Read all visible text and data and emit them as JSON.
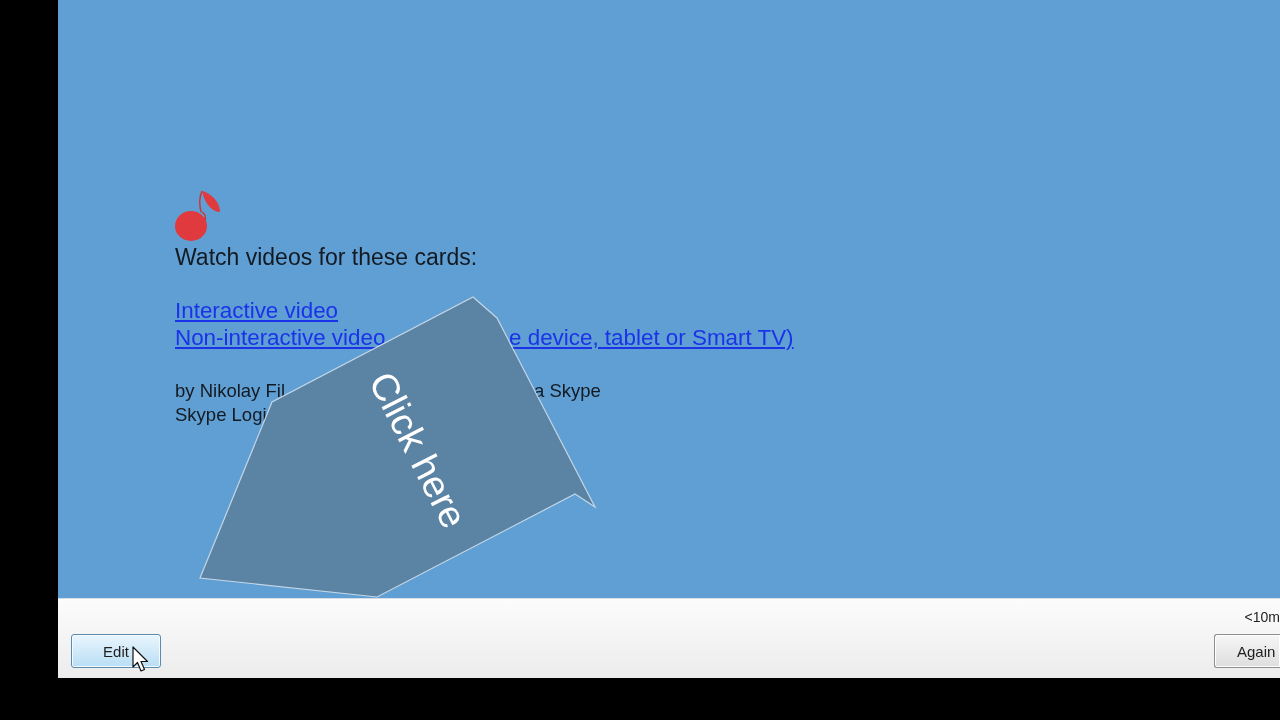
{
  "window": {
    "content": {
      "heading": "Watch videos for these cards:",
      "links": [
        {
          "parts": [
            "Interactive video"
          ]
        },
        {
          "parts": [
            "Non-interactive video",
            "e device, tablet or Smart TV)"
          ]
        }
      ],
      "byline": [
        {
          "parts": [
            "by Nikolay Fil",
            "a Skype"
          ]
        },
        {
          "parts": [
            "Skype Logi"
          ]
        }
      ]
    },
    "callout": {
      "label": "Click here"
    },
    "bottom_bar": {
      "buttons": [
        {
          "label": "Edit",
          "hovered": true
        },
        {
          "label": "Again",
          "hovered": false,
          "interval": "<10m"
        }
      ]
    }
  }
}
